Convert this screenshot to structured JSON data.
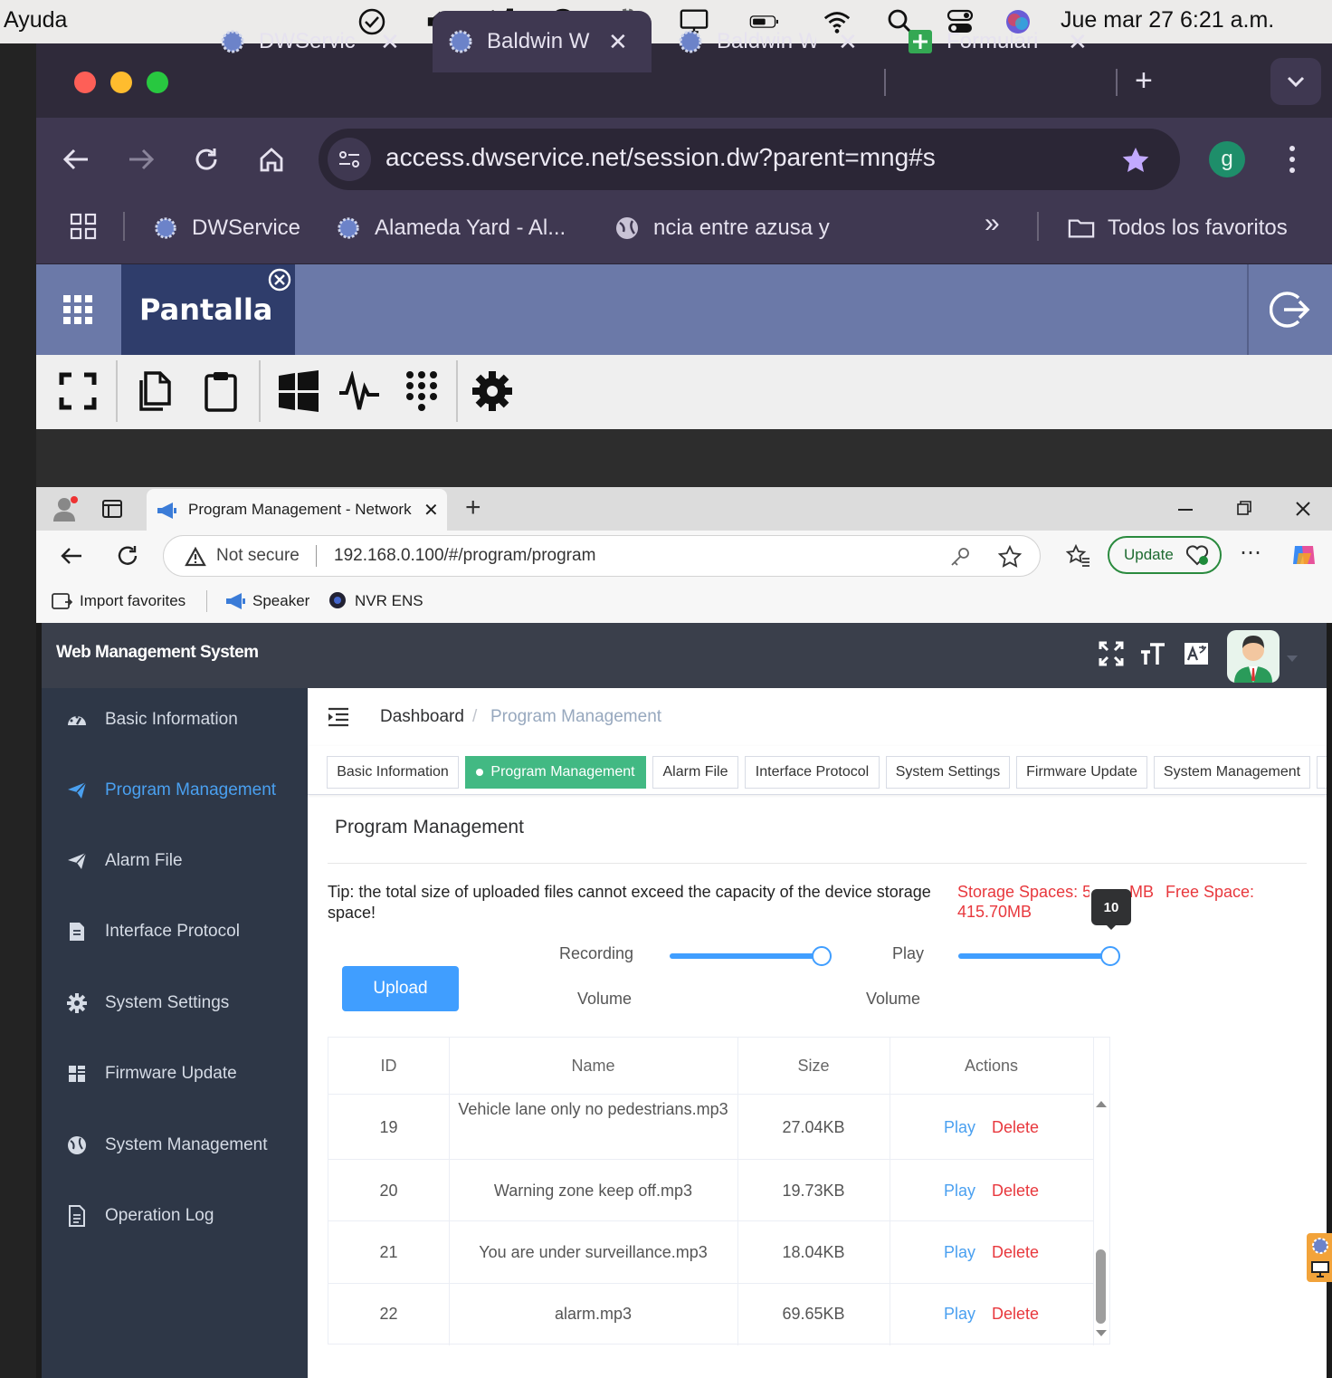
{
  "menubar": {
    "app_menu": "Ayuda",
    "datetime": "Jue mar 27  6:21 a.m."
  },
  "chrome": {
    "tabs": [
      {
        "title": "DWServic",
        "active": false
      },
      {
        "title": "Baldwin W",
        "active": true
      },
      {
        "title": "Baldwin W",
        "active": false
      },
      {
        "title": "Formulari",
        "active": false
      }
    ],
    "new_tab": "+",
    "url": "access.dwservice.net/session.dw?parent=mng#s",
    "profile_initial": "g",
    "bookmarks": [
      {
        "label": "DWService"
      },
      {
        "label": "Alameda Yard - Al..."
      },
      {
        "label": "ncia entre azusa y"
      }
    ],
    "more_bookmarks": "»",
    "all_bookmarks": "Todos los favoritos"
  },
  "dwservice": {
    "panel_title": "Pantalla"
  },
  "edge": {
    "tab_title": "Program Management - Network",
    "not_secure": "Not secure",
    "url": "192.168.0.100/#/program/program",
    "update_label": "Update",
    "bookmarks": [
      "Import favorites",
      "Speaker",
      "NVR ENS"
    ]
  },
  "wm": {
    "system_title": "Web Management System",
    "sidebar": [
      {
        "label": "Basic Information",
        "icon": "dashboard-icon",
        "active": false
      },
      {
        "label": "Program Management",
        "icon": "send-icon",
        "active": true
      },
      {
        "label": "Alarm File",
        "icon": "send-icon",
        "active": false
      },
      {
        "label": "Interface Protocol",
        "icon": "document-icon",
        "active": false
      },
      {
        "label": "System Settings",
        "icon": "gear-icon",
        "active": false
      },
      {
        "label": "Firmware Update",
        "icon": "grid-icon",
        "active": false
      },
      {
        "label": "System Management",
        "icon": "globe-icon",
        "active": false
      },
      {
        "label": "Operation Log",
        "icon": "log-icon",
        "active": false
      }
    ],
    "breadcrumb": {
      "home": "Dashboard",
      "sep": "/",
      "current": "Program Management"
    },
    "tags": [
      "Basic Information",
      "Program Management",
      "Alarm File",
      "Interface Protocol",
      "System Settings",
      "Firmware Update",
      "System Management"
    ],
    "page_title": "Program Management",
    "tip": "Tip: the total size of uploaded files cannot exceed the capacity of the device storage space!",
    "storage_label": "Storage Spaces: 51",
    "storage_tail": "MB",
    "storage_line2": "415.70MB",
    "free_label": "Free Space:",
    "recording_label_1": "Recording",
    "recording_label_2": "Volume",
    "play_label_1": "Play",
    "play_label_2": "Volume",
    "play_tooltip": "10",
    "recording_volume_fraction": 1.0,
    "play_volume_fraction": 1.0,
    "upload_label": "Upload",
    "table": {
      "headers": [
        "ID",
        "Name",
        "Size",
        "Actions"
      ],
      "rows": [
        {
          "id": "19",
          "name": "Vehicle lane only no pedestrians.mp3",
          "size": "27.04KB"
        },
        {
          "id": "20",
          "name": "Warning zone keep off.mp3",
          "size": "19.73KB"
        },
        {
          "id": "21",
          "name": "You are under surveillance.mp3",
          "size": "18.04KB"
        },
        {
          "id": "22",
          "name": "alarm.mp3",
          "size": "69.65KB"
        }
      ],
      "play_label": "Play",
      "delete_label": "Delete"
    }
  },
  "colors": {
    "accent_blue": "#409eff",
    "active_green": "#42b983",
    "danger_red": "#e8383d",
    "sidebar_bg": "#2e3747"
  }
}
